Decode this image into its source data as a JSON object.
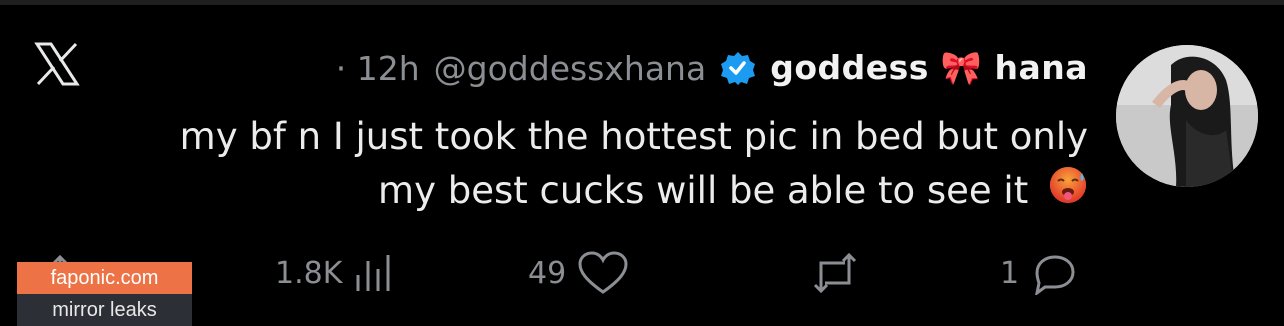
{
  "post": {
    "display_name": "goddess 🎀 hana",
    "handle": "@goddessxhana",
    "time": "· 12h",
    "text_line1": "my bf n I just took the hottest pic in bed but only",
    "text_line2": "my best cucks will be able to see it",
    "emoji": "hot-face-sweat"
  },
  "actions": {
    "replies": "1",
    "likes": "49",
    "views": "1.8K"
  },
  "icons": {
    "verified": "verified-badge-icon",
    "app": "x-logo-icon",
    "reply": "reply-icon",
    "retweet": "retweet-icon",
    "like": "heart-icon",
    "views": "views-icon",
    "share": "share-icon"
  },
  "colors": {
    "background": "#000000",
    "verified": "#1d9bf0",
    "watermark_top": "#ed7245",
    "watermark_bottom": "#2d2f36"
  },
  "watermark": {
    "site": "faponic.com",
    "tagline": "mirror leaks"
  }
}
